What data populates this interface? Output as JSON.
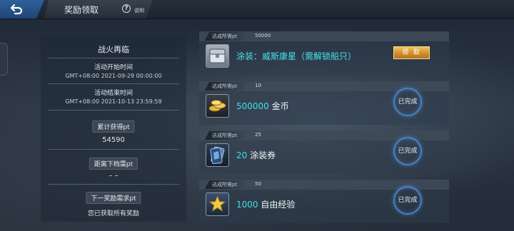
{
  "header": {
    "title": "奖励领取",
    "help_label": "说明"
  },
  "event": {
    "name": "战火再临",
    "start_label": "活动开始时间",
    "start_time": "GMT+08:00 2021-09-29 00:00:00",
    "end_label": "活动结束时间",
    "end_time": "GMT+08:00 2021-10-13 23:59:59",
    "total_label": "累计获得pt",
    "total_value": "54590",
    "next_tier_label": "距离下档需pt",
    "next_tier_value": "– –",
    "next_reward_label": "下一奖励需求pt",
    "all_claimed_text": "您已获取所有奖励"
  },
  "rewards": [
    {
      "req_label": "达成所需pt",
      "req_value": "50000",
      "reward_text": "涂装：威斯康星（需解锁船只）",
      "status": "领 取",
      "icon": "chest-icon"
    },
    {
      "req_label": "达成所需pt",
      "req_value": "10",
      "reward_amount": "500000",
      "reward_name": "金币",
      "status": "已完成",
      "icon": "gold-coins-icon"
    },
    {
      "req_label": "达成所需pt",
      "req_value": "25",
      "reward_amount": "20",
      "reward_name": "涂装券",
      "status": "已完成",
      "icon": "camo-voucher-icon"
    },
    {
      "req_label": "达成所需pt",
      "req_value": "50",
      "reward_amount": "1000",
      "reward_name": "自由经验",
      "status": "已完成",
      "icon": "star-xp-icon"
    }
  ],
  "colors": {
    "accent_cyan": "#3ee0e8",
    "claim_gold": "#e0a53c",
    "done_ring": "#508cd2"
  }
}
